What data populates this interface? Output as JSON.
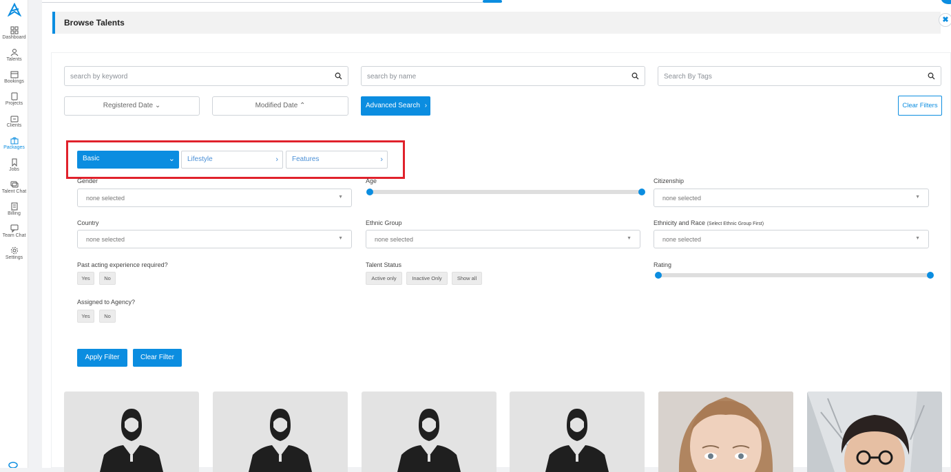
{
  "sidebar": {
    "items": [
      {
        "label": "Dashboard",
        "icon": "dashboard-grid-icon"
      },
      {
        "label": "Talents",
        "icon": "talents-people-icon"
      },
      {
        "label": "Bookings",
        "icon": "bookings-calendar-icon"
      },
      {
        "label": "Projects",
        "icon": "projects-icon"
      },
      {
        "label": "Clients",
        "icon": "clients-briefcase-icon"
      },
      {
        "label": "Packages",
        "icon": "packages-gift-icon"
      },
      {
        "label": "Jobs",
        "icon": "jobs-bookmark-icon"
      },
      {
        "label": "Talent Chat",
        "icon": "talent-chat-icon"
      },
      {
        "label": "Billing",
        "icon": "billing-icon"
      },
      {
        "label": "Team Chat",
        "icon": "team-chat-icon"
      },
      {
        "label": "Settings",
        "icon": "settings-gear-icon"
      }
    ],
    "active": "Packages"
  },
  "header": {
    "title": "Browse Talents"
  },
  "search": {
    "keyword_placeholder": "search by keyword",
    "name_placeholder": "search by name",
    "tags_placeholder": "Search By Tags"
  },
  "filters_bar": {
    "registered_date": "Registered Date",
    "modified_date": "Modified Date",
    "advanced_search": "Advanced Search",
    "clear_filters": "Clear Filters"
  },
  "tabs": [
    {
      "label": "Basic",
      "active": true
    },
    {
      "label": "Lifestyle",
      "active": false
    },
    {
      "label": "Features",
      "active": false
    }
  ],
  "fields": {
    "gender": {
      "label": "Gender",
      "value": "none selected"
    },
    "age": {
      "label": "Age",
      "range_start": 0,
      "range_end": 1
    },
    "citizenship": {
      "label": "Citizenship",
      "value": "none selected"
    },
    "country": {
      "label": "Country",
      "value": "none selected"
    },
    "ethnic_group": {
      "label": "Ethnic Group",
      "value": "none selected"
    },
    "ethnicity": {
      "label": "Ethnicity and Race",
      "note": "(Select Ethnic Group First)",
      "value": "none selected"
    },
    "past_acting": {
      "label": "Past acting experience required?",
      "options": [
        "Yes",
        "No"
      ]
    },
    "talent_status": {
      "label": "Talent Status",
      "options": [
        "Active only",
        "Inactive Only",
        "Show all"
      ]
    },
    "rating": {
      "label": "Rating",
      "range_start": 0,
      "range_end": 1
    },
    "assigned_agency": {
      "label": "Assigned to Agency?",
      "options": [
        "Yes",
        "No"
      ]
    }
  },
  "actions": {
    "apply": "Apply Filter",
    "clear": "Clear Filter"
  },
  "colors": {
    "accent": "#0b8de0",
    "highlight": "#e0212b"
  }
}
